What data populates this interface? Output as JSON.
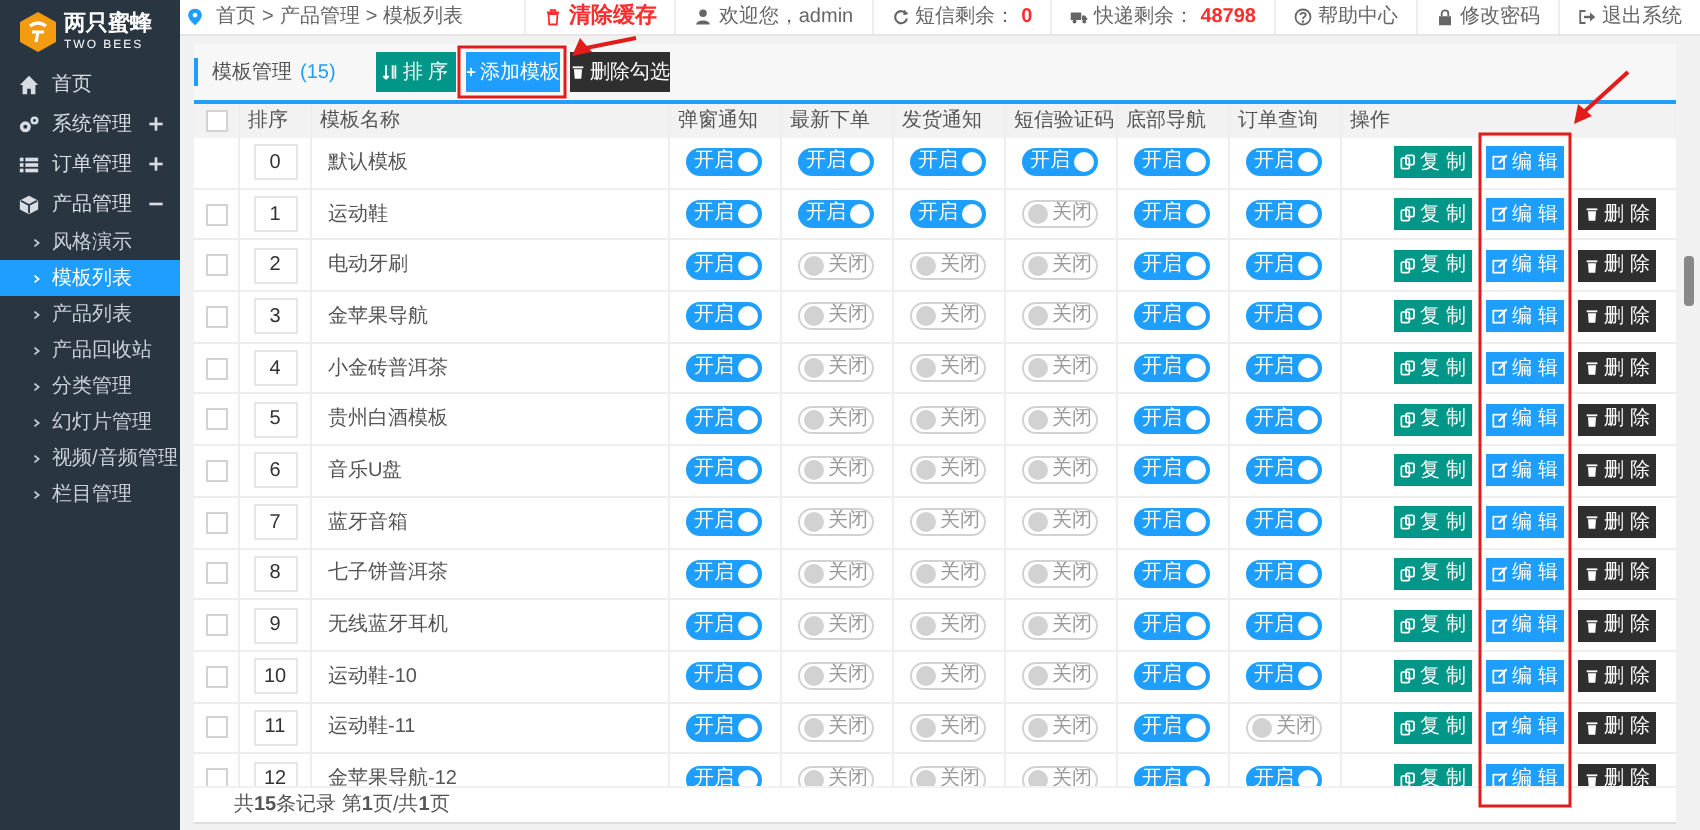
{
  "logo": {
    "name": "两只蜜蜂",
    "subtitle": "TWO BEES"
  },
  "breadcrumb": [
    "首页",
    "产品管理",
    "模板列表"
  ],
  "breadcrumb_separator": ">",
  "top_links": [
    {
      "kind": "clear",
      "label": "清除缓存"
    },
    {
      "kind": "user",
      "label": "欢迎您，admin"
    },
    {
      "kind": "sms",
      "label": "短信剩余：",
      "value": "0"
    },
    {
      "kind": "express",
      "label": "快递剩余：",
      "value": "48798"
    },
    {
      "kind": "help",
      "label": "帮助中心"
    },
    {
      "kind": "password",
      "label": "修改密码"
    },
    {
      "kind": "logout",
      "label": "退出系统"
    }
  ],
  "sidebar": {
    "items": [
      {
        "label": "首页"
      },
      {
        "label": "系统管理",
        "expanded": false
      },
      {
        "label": "订单管理",
        "expanded": false
      },
      {
        "label": "产品管理",
        "expanded": true,
        "children": [
          {
            "label": "风格演示",
            "selected": false
          },
          {
            "label": "模板列表",
            "selected": true
          },
          {
            "label": "产品列表",
            "selected": false
          },
          {
            "label": "产品回收站",
            "selected": false
          },
          {
            "label": "分类管理",
            "selected": false
          },
          {
            "label": "幻灯片管理",
            "selected": false
          },
          {
            "label": "视频/音频管理",
            "selected": false
          },
          {
            "label": "栏目管理",
            "selected": false
          }
        ]
      }
    ]
  },
  "panel": {
    "title": "模板管理",
    "count": "(15)",
    "buttons": [
      {
        "kind": "sort",
        "label": "排 序"
      },
      {
        "kind": "add",
        "label": "添加模板"
      },
      {
        "kind": "delete",
        "label": "删除勾选"
      }
    ]
  },
  "table": {
    "header_checkbox": {
      "checked": false
    },
    "columns": [
      "排序",
      "模板名称",
      "弹窗通知",
      "最新下单",
      "发货通知",
      "短信验证码",
      "底部导航",
      "订单查询",
      "操作"
    ],
    "rows": [
      {
        "sort": "0",
        "name": "默认模板",
        "switches": [
          {
            "on": true,
            "label": "开启"
          },
          {
            "on": true,
            "label": "开启"
          },
          {
            "on": true,
            "label": "开启"
          },
          {
            "on": true,
            "label": "开启"
          },
          {
            "on": true,
            "label": "开启"
          },
          {
            "on": true,
            "label": "开启"
          }
        ],
        "actions": [
          {
            "kind": "copy",
            "label": "复 制"
          },
          {
            "kind": "edit",
            "label": "编 辑"
          }
        ]
      },
      {
        "checked": false,
        "sort": "1",
        "name": "运动鞋",
        "switches": [
          {
            "on": true,
            "label": "开启"
          },
          {
            "on": true,
            "label": "开启"
          },
          {
            "on": true,
            "label": "开启"
          },
          {
            "on": false,
            "label": "关闭"
          },
          {
            "on": true,
            "label": "开启"
          },
          {
            "on": true,
            "label": "开启"
          }
        ],
        "actions": [
          {
            "kind": "copy",
            "label": "复 制"
          },
          {
            "kind": "edit",
            "label": "编 辑"
          },
          {
            "kind": "delete",
            "label": "删 除"
          }
        ]
      },
      {
        "checked": false,
        "sort": "2",
        "name": "电动牙刷",
        "switches": [
          {
            "on": true,
            "label": "开启"
          },
          {
            "on": false,
            "label": "关闭"
          },
          {
            "on": false,
            "label": "关闭"
          },
          {
            "on": false,
            "label": "关闭"
          },
          {
            "on": true,
            "label": "开启"
          },
          {
            "on": true,
            "label": "开启"
          }
        ],
        "actions": [
          {
            "kind": "copy",
            "label": "复 制"
          },
          {
            "kind": "edit",
            "label": "编 辑"
          },
          {
            "kind": "delete",
            "label": "删 除"
          }
        ]
      },
      {
        "checked": false,
        "sort": "3",
        "name": "金苹果导航",
        "switches": [
          {
            "on": true,
            "label": "开启"
          },
          {
            "on": false,
            "label": "关闭"
          },
          {
            "on": false,
            "label": "关闭"
          },
          {
            "on": false,
            "label": "关闭"
          },
          {
            "on": true,
            "label": "开启"
          },
          {
            "on": true,
            "label": "开启"
          }
        ],
        "actions": [
          {
            "kind": "copy",
            "label": "复 制"
          },
          {
            "kind": "edit",
            "label": "编 辑"
          },
          {
            "kind": "delete",
            "label": "删 除"
          }
        ]
      },
      {
        "checked": false,
        "sort": "4",
        "name": "小金砖普洱茶",
        "switches": [
          {
            "on": true,
            "label": "开启"
          },
          {
            "on": false,
            "label": "关闭"
          },
          {
            "on": false,
            "label": "关闭"
          },
          {
            "on": false,
            "label": "关闭"
          },
          {
            "on": true,
            "label": "开启"
          },
          {
            "on": true,
            "label": "开启"
          }
        ],
        "actions": [
          {
            "kind": "copy",
            "label": "复 制"
          },
          {
            "kind": "edit",
            "label": "编 辑"
          },
          {
            "kind": "delete",
            "label": "删 除"
          }
        ]
      },
      {
        "checked": false,
        "sort": "5",
        "name": "贵州白酒模板",
        "switches": [
          {
            "on": true,
            "label": "开启"
          },
          {
            "on": false,
            "label": "关闭"
          },
          {
            "on": false,
            "label": "关闭"
          },
          {
            "on": false,
            "label": "关闭"
          },
          {
            "on": true,
            "label": "开启"
          },
          {
            "on": true,
            "label": "开启"
          }
        ],
        "actions": [
          {
            "kind": "copy",
            "label": "复 制"
          },
          {
            "kind": "edit",
            "label": "编 辑"
          },
          {
            "kind": "delete",
            "label": "删 除"
          }
        ]
      },
      {
        "checked": false,
        "sort": "6",
        "name": "音乐U盘",
        "switches": [
          {
            "on": true,
            "label": "开启"
          },
          {
            "on": false,
            "label": "关闭"
          },
          {
            "on": false,
            "label": "关闭"
          },
          {
            "on": false,
            "label": "关闭"
          },
          {
            "on": true,
            "label": "开启"
          },
          {
            "on": true,
            "label": "开启"
          }
        ],
        "actions": [
          {
            "kind": "copy",
            "label": "复 制"
          },
          {
            "kind": "edit",
            "label": "编 辑"
          },
          {
            "kind": "delete",
            "label": "删 除"
          }
        ]
      },
      {
        "checked": false,
        "sort": "7",
        "name": "蓝牙音箱",
        "switches": [
          {
            "on": true,
            "label": "开启"
          },
          {
            "on": false,
            "label": "关闭"
          },
          {
            "on": false,
            "label": "关闭"
          },
          {
            "on": false,
            "label": "关闭"
          },
          {
            "on": true,
            "label": "开启"
          },
          {
            "on": true,
            "label": "开启"
          }
        ],
        "actions": [
          {
            "kind": "copy",
            "label": "复 制"
          },
          {
            "kind": "edit",
            "label": "编 辑"
          },
          {
            "kind": "delete",
            "label": "删 除"
          }
        ]
      },
      {
        "checked": false,
        "sort": "8",
        "name": "七子饼普洱茶",
        "switches": [
          {
            "on": true,
            "label": "开启"
          },
          {
            "on": false,
            "label": "关闭"
          },
          {
            "on": false,
            "label": "关闭"
          },
          {
            "on": false,
            "label": "关闭"
          },
          {
            "on": true,
            "label": "开启"
          },
          {
            "on": true,
            "label": "开启"
          }
        ],
        "actions": [
          {
            "kind": "copy",
            "label": "复 制"
          },
          {
            "kind": "edit",
            "label": "编 辑"
          },
          {
            "kind": "delete",
            "label": "删 除"
          }
        ]
      },
      {
        "checked": false,
        "sort": "9",
        "name": "无线蓝牙耳机",
        "switches": [
          {
            "on": true,
            "label": "开启"
          },
          {
            "on": false,
            "label": "关闭"
          },
          {
            "on": false,
            "label": "关闭"
          },
          {
            "on": false,
            "label": "关闭"
          },
          {
            "on": true,
            "label": "开启"
          },
          {
            "on": true,
            "label": "开启"
          }
        ],
        "actions": [
          {
            "kind": "copy",
            "label": "复 制"
          },
          {
            "kind": "edit",
            "label": "编 辑"
          },
          {
            "kind": "delete",
            "label": "删 除"
          }
        ]
      },
      {
        "checked": false,
        "sort": "10",
        "name": "运动鞋-10",
        "switches": [
          {
            "on": true,
            "label": "开启"
          },
          {
            "on": false,
            "label": "关闭"
          },
          {
            "on": false,
            "label": "关闭"
          },
          {
            "on": false,
            "label": "关闭"
          },
          {
            "on": true,
            "label": "开启"
          },
          {
            "on": true,
            "label": "开启"
          }
        ],
        "actions": [
          {
            "kind": "copy",
            "label": "复 制"
          },
          {
            "kind": "edit",
            "label": "编 辑"
          },
          {
            "kind": "delete",
            "label": "删 除"
          }
        ]
      },
      {
        "checked": false,
        "sort": "11",
        "name": "运动鞋-11",
        "switches": [
          {
            "on": true,
            "label": "开启"
          },
          {
            "on": false,
            "label": "关闭"
          },
          {
            "on": false,
            "label": "关闭"
          },
          {
            "on": false,
            "label": "关闭"
          },
          {
            "on": true,
            "label": "开启"
          },
          {
            "on": false,
            "label": "关闭"
          }
        ],
        "actions": [
          {
            "kind": "copy",
            "label": "复 制"
          },
          {
            "kind": "edit",
            "label": "编 辑"
          },
          {
            "kind": "delete",
            "label": "删 除"
          }
        ]
      },
      {
        "checked": false,
        "sort": "12",
        "name": "金苹果导航-12",
        "switches": [
          {
            "on": true,
            "label": "开启"
          },
          {
            "on": false,
            "label": "关闭"
          },
          {
            "on": false,
            "label": "关闭"
          },
          {
            "on": false,
            "label": "关闭"
          },
          {
            "on": true,
            "label": "开启"
          },
          {
            "on": true,
            "label": "开启"
          }
        ],
        "actions": [
          {
            "kind": "copy",
            "label": "复 制"
          },
          {
            "kind": "edit",
            "label": "编 辑"
          },
          {
            "kind": "delete",
            "label": "删 除"
          }
        ]
      }
    ]
  },
  "footer": "共**15**条记录 第**1**页/共**1**页"
}
